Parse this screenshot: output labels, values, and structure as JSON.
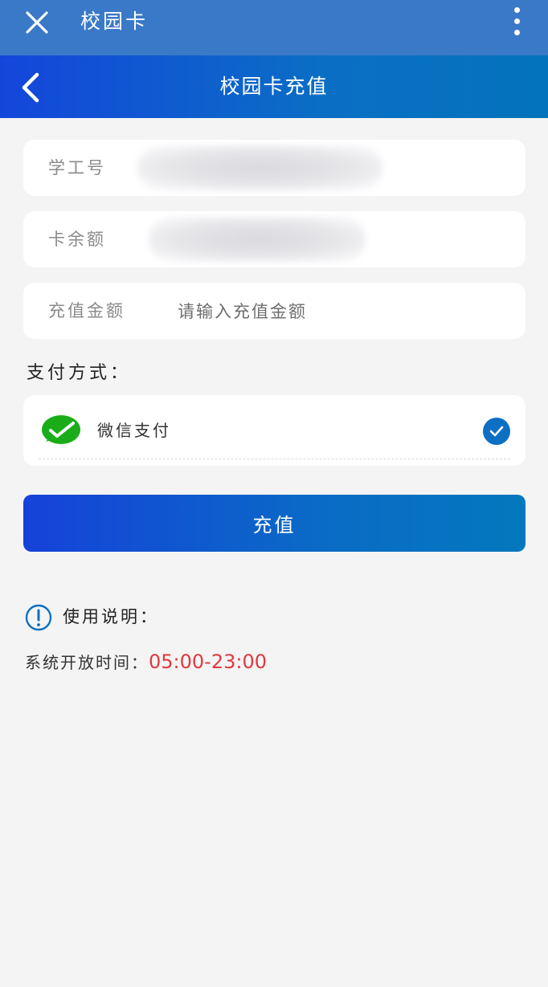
{
  "window": {
    "title": "校园卡",
    "close_icon": "close-icon",
    "more_icon": "more-vertical-icon"
  },
  "header": {
    "title": "校园卡充值",
    "back_icon": "chevron-left-icon"
  },
  "form": {
    "student_id": {
      "label": "学工号"
    },
    "balance": {
      "label": "卡余额"
    },
    "amount": {
      "label": "充值金额",
      "placeholder": "请输入充值金额",
      "value": ""
    }
  },
  "payment": {
    "section_label": "支付方式：",
    "methods": [
      {
        "label": "微信支付",
        "icon": "wechat-pay-icon",
        "selected": true
      }
    ]
  },
  "actions": {
    "submit_label": "充值"
  },
  "notes": {
    "title": "使用说明：",
    "hours_label": "系统开放时间：",
    "hours_value": "05:00-23:00"
  },
  "colors": {
    "topbar": "#3a79c7",
    "header_gradient_start": "#1446db",
    "header_gradient_end": "#0473bd",
    "accent": "#0d6fc3",
    "wechat_green": "#1aad19",
    "time_red": "#e0393f"
  }
}
